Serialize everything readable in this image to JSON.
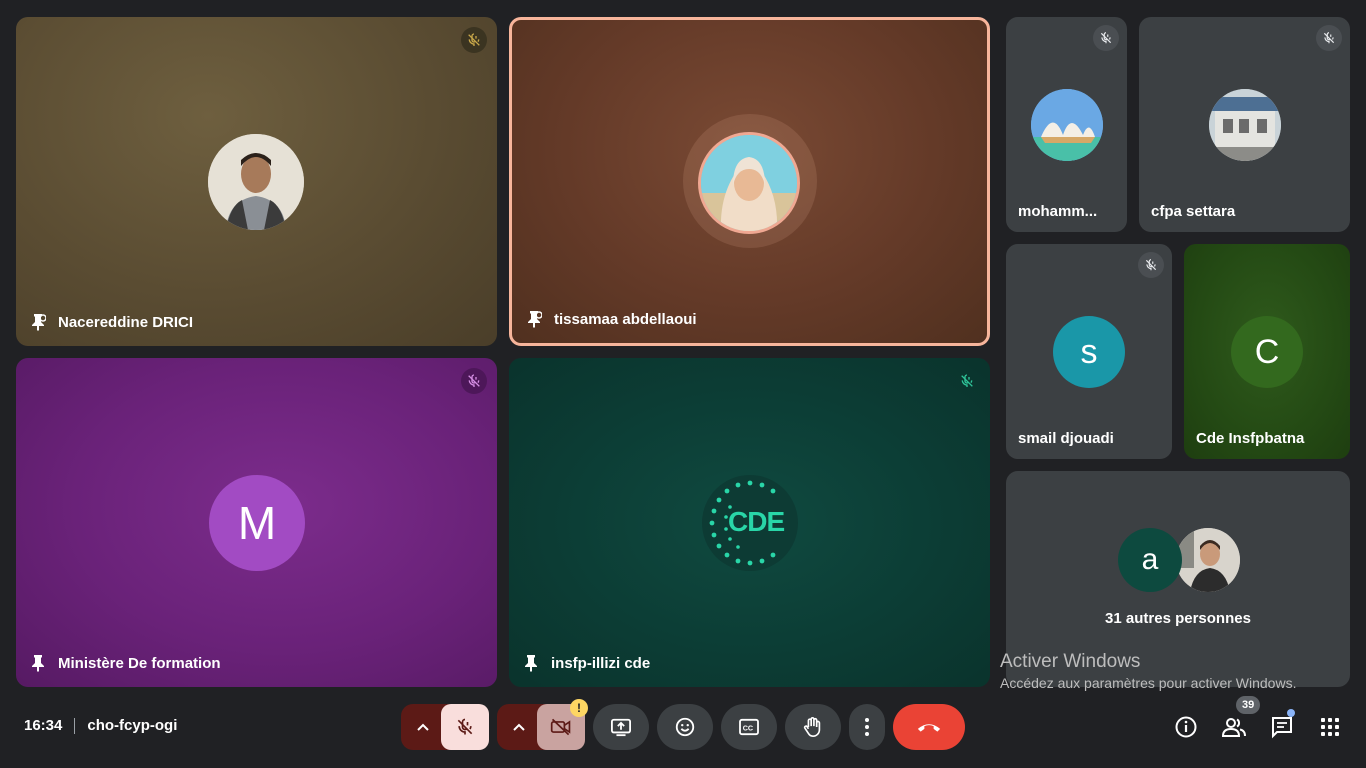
{
  "tiles": {
    "nacereddine": {
      "name": "Nacereddine DRICI"
    },
    "tissamaa": {
      "name": "tissamaa abdellaoui"
    },
    "ministere": {
      "name": "Ministère De formation",
      "initial": "M"
    },
    "insfp_illizi": {
      "name": "insfp-illizi cde",
      "logo_text": "CDE"
    },
    "mohamm": {
      "name": "mohamm..."
    },
    "cfpa": {
      "name": "cfpa settara"
    },
    "smail": {
      "name": "smail djouadi",
      "initial": "s"
    },
    "cde_batna": {
      "name": "Cde Insfpbatna",
      "initial": "C"
    },
    "others": {
      "label": "31 autres personnes",
      "initial": "a"
    }
  },
  "bar": {
    "time": "16:34",
    "meeting_code": "cho-fcyp-ogi",
    "people_count": "39",
    "camera_warning": "!"
  },
  "watermark": {
    "line1": "Activer Windows",
    "line2": "Accédez aux paramètres pour activer Windows."
  },
  "icons": [
    "pin-icon",
    "mic-off-icon",
    "chevron-up-icon",
    "camera-off-icon",
    "present-icon",
    "emoji-icon",
    "captions-icon",
    "hand-icon",
    "more-icon",
    "end-call-icon",
    "info-icon",
    "people-icon",
    "chat-icon",
    "apps-icon"
  ],
  "colors": {
    "end_call": "#ea4335",
    "active_speaker_border": "#f7b59b",
    "control_bg": "#3c4043"
  }
}
